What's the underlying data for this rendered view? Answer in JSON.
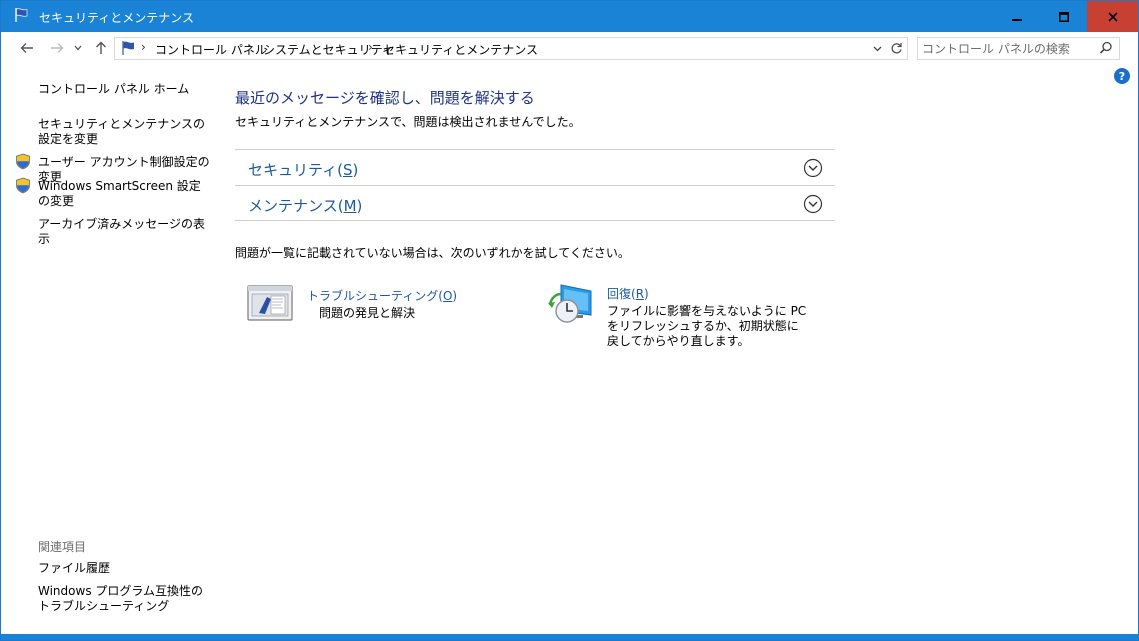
{
  "window": {
    "title": "セキュリティとメンテナンス",
    "accent": "#1b83d6",
    "close_color": "#c84031"
  },
  "titlebar_buttons": {
    "minimize_icon": "minimize-icon",
    "maximize_icon": "maximize-icon",
    "close_icon": "close-icon"
  },
  "nav": {
    "back_icon": "back-arrow-icon",
    "forward_icon": "forward-arrow-icon",
    "recent_icon": "chevron-down-icon",
    "up_icon": "up-arrow-icon"
  },
  "breadcrumb": {
    "items": [
      "コントロール パネル",
      "システムとセキュリティ",
      "セキュリティとメンテナンス"
    ],
    "separator": "›"
  },
  "search": {
    "placeholder": "コントロール パネルの検索"
  },
  "help": {
    "label": "?"
  },
  "sidebar": {
    "home": "コントロール パネル ホーム",
    "items": [
      {
        "label": "セキュリティとメンテナンスの設定を変更",
        "shield": false
      },
      {
        "label": "ユーザー アカウント制御設定の変更",
        "shield": true
      },
      {
        "label": "Windows SmartScreen 設定の変更",
        "shield": true
      },
      {
        "label": "アーカイブ済みメッセージの表示",
        "shield": false
      }
    ],
    "related_heading": "関連項目",
    "related": [
      {
        "label": "ファイル履歴"
      },
      {
        "label": "Windows プログラム互換性のトラブルシューティング"
      }
    ]
  },
  "main": {
    "heading": "最近のメッセージを確認し、問題を解決する",
    "status": "セキュリティとメンテナンスで、問題は検出されませんでした。",
    "sections": [
      {
        "label": "セキュリティ",
        "accesskey": "S"
      },
      {
        "label": "メンテナンス",
        "accesskey": "M"
      }
    ],
    "try_text": "問題が一覧に記載されていない場合は、次のいずれかを試してください。",
    "tools": [
      {
        "title": "トラブルシューティング",
        "accesskey": "O",
        "description": "問題の発見と解決",
        "icon": "troubleshooting-icon"
      },
      {
        "title": "回復",
        "accesskey": "R",
        "description": "ファイルに影響を与えないように PC をリフレッシュするか、初期状態に戻してからやり直します。",
        "icon": "recovery-icon"
      }
    ]
  }
}
